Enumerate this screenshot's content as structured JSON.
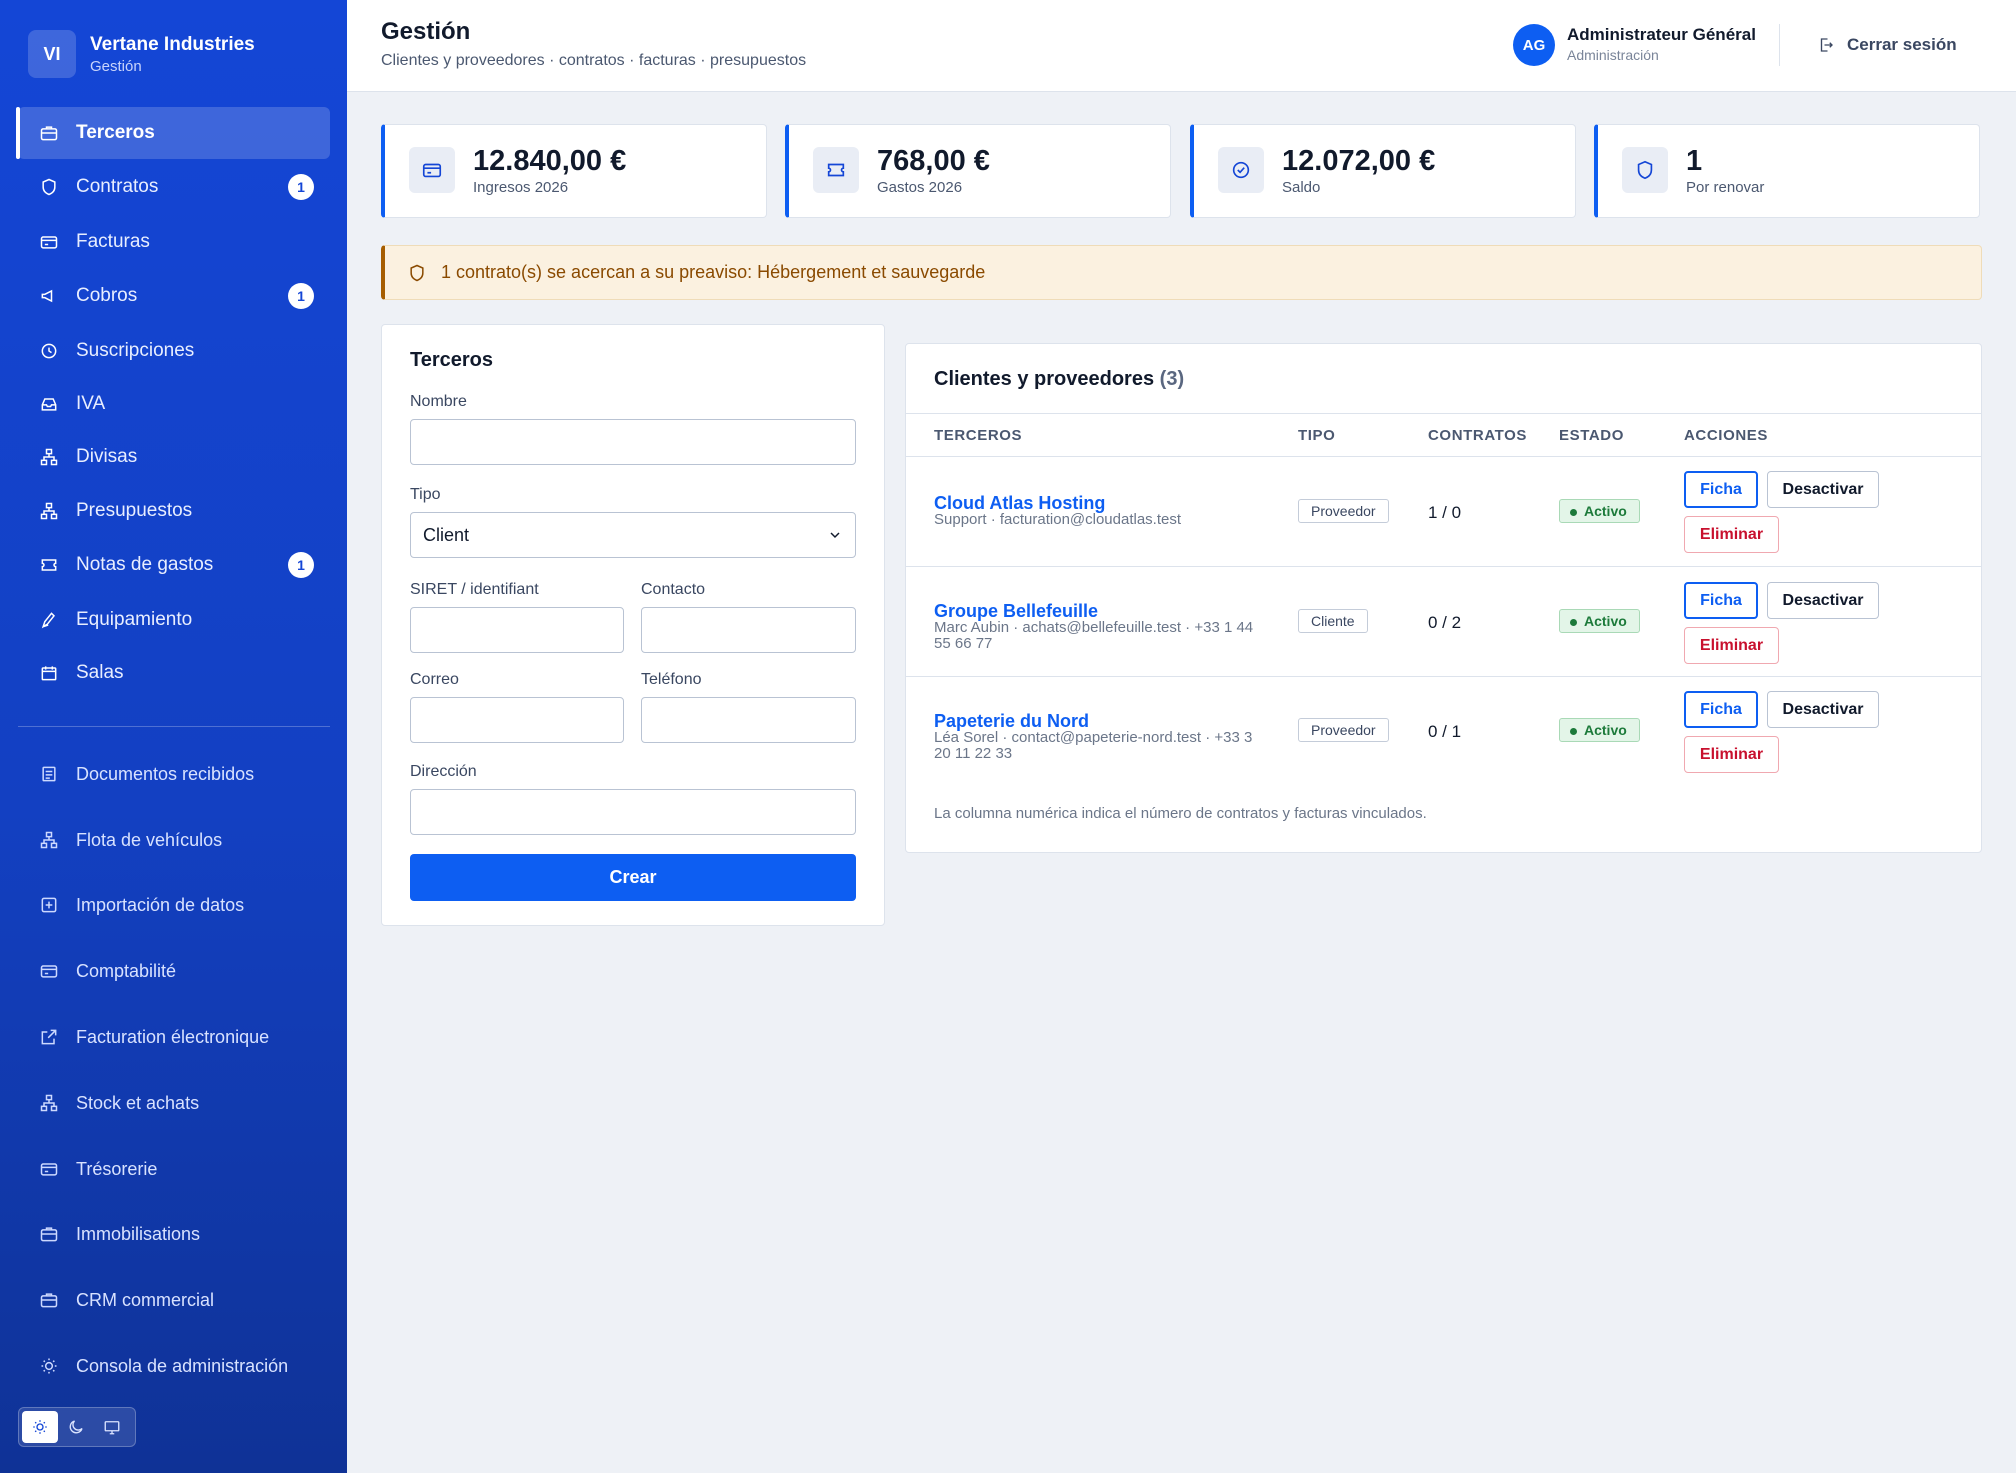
{
  "brand": {
    "initials": "VI",
    "name": "Vertane Industries",
    "subtitle": "Gestión"
  },
  "sidebar": {
    "items": [
      {
        "label": "Terceros",
        "icon": "briefcase-icon",
        "active": true
      },
      {
        "label": "Contratos",
        "icon": "shield-icon",
        "badge": "1"
      },
      {
        "label": "Facturas",
        "icon": "credit-card-icon"
      },
      {
        "label": "Cobros",
        "icon": "megaphone-icon",
        "badge": "1"
      },
      {
        "label": "Suscripciones",
        "icon": "clock-icon"
      },
      {
        "label": "IVA",
        "icon": "inbox-icon"
      },
      {
        "label": "Divisas",
        "icon": "network-icon"
      },
      {
        "label": "Presupuestos",
        "icon": "network-icon"
      },
      {
        "label": "Notas de gastos",
        "icon": "ticket-icon",
        "badge": "1"
      },
      {
        "label": "Equipamiento",
        "icon": "pen-icon"
      },
      {
        "label": "Salas",
        "icon": "calendar-icon"
      }
    ],
    "secondary_items": [
      {
        "label": "Documentos recibidos",
        "icon": "document-icon"
      },
      {
        "label": "Flota de vehículos",
        "icon": "network-icon"
      },
      {
        "label": "Importación de datos",
        "icon": "plus-square-icon"
      },
      {
        "label": "Comptabilité",
        "icon": "credit-card-icon"
      },
      {
        "label": "Facturation électronique",
        "icon": "external-link-icon"
      },
      {
        "label": "Stock et achats",
        "icon": "network-icon"
      },
      {
        "label": "Trésorerie",
        "icon": "credit-card-icon"
      },
      {
        "label": "Immobilisations",
        "icon": "briefcase-icon"
      },
      {
        "label": "CRM commercial",
        "icon": "briefcase-icon"
      },
      {
        "label": "Consola de administración",
        "icon": "sun-icon"
      }
    ],
    "theme": [
      "sun-icon",
      "moon-icon",
      "monitor-icon"
    ]
  },
  "header": {
    "title": "Gestión",
    "subtitle": "Clientes y proveedores · contratos · facturas · presupuestos",
    "user": {
      "initials": "AG",
      "name": "Administrateur Général",
      "role": "Administración"
    },
    "logout_label": "Cerrar sesión"
  },
  "stats": [
    {
      "value": "12.840,00 €",
      "label": "Ingresos 2026",
      "icon": "credit-card-icon"
    },
    {
      "value": "768,00 €",
      "label": "Gastos 2026",
      "icon": "ticket-icon"
    },
    {
      "value": "12.072,00 €",
      "label": "Saldo",
      "icon": "check-circle-icon"
    },
    {
      "value": "1",
      "label": "Por renovar",
      "icon": "shield-icon"
    }
  ],
  "alert": {
    "text": "1 contrato(s) se acercan a su preaviso: Hébergement et sauvegarde",
    "icon": "shield-icon"
  },
  "form": {
    "title": "Terceros",
    "name_label": "Nombre",
    "type_label": "Tipo",
    "type_value": "Client",
    "siret_label": "SIRET / identifiant",
    "contact_label": "Contacto",
    "email_label": "Correo",
    "phone_label": "Teléfono",
    "address_label": "Dirección",
    "submit_label": "Crear"
  },
  "table": {
    "title": "Clientes y proveedores",
    "count": "(3)",
    "columns": [
      "TERCEROS",
      "TIPO",
      "CONTRATOS",
      "ESTADO",
      "ACCIONES"
    ],
    "rows": [
      {
        "name": "Cloud Atlas Hosting",
        "detail": "Support · facturation@cloudatlas.test",
        "type": "Proveedor",
        "counts": "1 / 0",
        "status": "Activo"
      },
      {
        "name": "Groupe Bellefeuille",
        "detail": "Marc Aubin · achats@bellefeuille.test · +33 1 44 55 66 77",
        "type": "Cliente",
        "counts": "0 / 2",
        "status": "Activo"
      },
      {
        "name": "Papeterie du Nord",
        "detail": "Léa Sorel · contact@papeterie-nord.test · +33 3 20 11 22 33",
        "type": "Proveedor",
        "counts": "0 / 1",
        "status": "Activo"
      }
    ],
    "actions": {
      "view": "Ficha",
      "deactivate": "Desactivar",
      "delete": "Eliminar"
    },
    "footnote": "La columna numérica indica el número de contratos y facturas vinculados."
  }
}
